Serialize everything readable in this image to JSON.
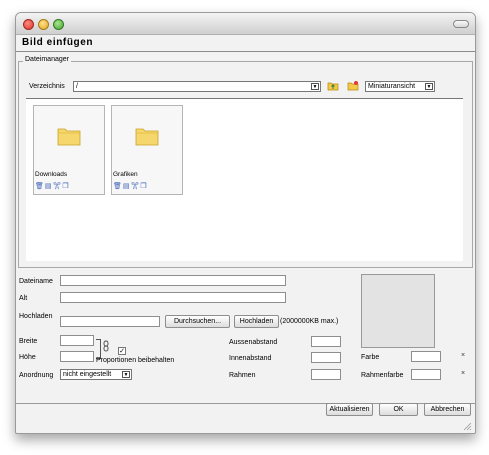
{
  "window": {
    "title": "Bild einfügen"
  },
  "filemanager": {
    "legend": "Dateimanager",
    "directory_label": "Verzeichnis",
    "directory_value": "/",
    "view_mode": "Miniaturansicht",
    "folders": [
      {
        "name": "Downloads"
      },
      {
        "name": "Grafiken"
      }
    ]
  },
  "form": {
    "filename_label": "Dateiname",
    "alt_label": "Alt",
    "upload_label": "Hochladen",
    "browse_button": "Durchsuchen...",
    "upload_button": "Hochladen",
    "upload_limit": "(2000000KB max.)",
    "width_label": "Breite",
    "height_label": "Höhe",
    "keep_proportions": "Proportionen beibehalten",
    "keep_proportions_checked": true,
    "alignment_label": "Anordnung",
    "alignment_value": "nicht eingestellt",
    "outer_margin_label": "Aussenabstand",
    "inner_margin_label": "Innenabstand",
    "border_label": "Rahmen",
    "color_label": "Farbe",
    "border_color_label": "Rahmenfarbe"
  },
  "footer": {
    "update_button": "Aktualisieren",
    "ok_button": "OK",
    "cancel_button": "Abbrechen"
  },
  "icons": {
    "folder_up": "folder-up-icon",
    "new_folder": "new-folder-icon",
    "folder": "folder-icon",
    "delete": "trash-icon",
    "rename": "rename-icon",
    "cut": "scissors-icon",
    "copy": "copy-icon",
    "link": "chain-link-icon",
    "clear": "clear-x-icon"
  }
}
